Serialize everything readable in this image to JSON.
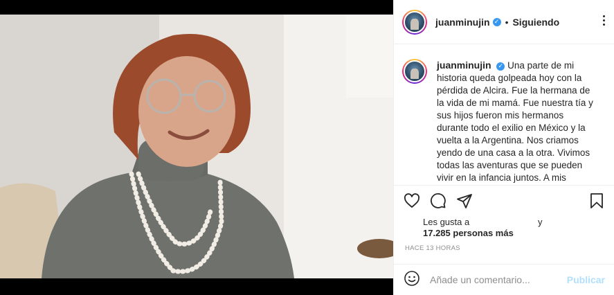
{
  "post": {
    "username": "juanminujin",
    "verified_glyph": "✓",
    "separator": "•",
    "follow_status": "Siguiendo",
    "caption": "Una parte de mi historia queda golpeada hoy con la pérdida de Alcira. Fue la hermana de la vida de mi mamá. Fue nuestra tía y sus hijos fueron mis hermanos durante todo el exilio en México y la vuelta a la Argentina. Nos criamos yendo de una casa a la otra. Vivimos todas las aventuras que se pueden vivir en la infancia juntos. A mis hermanos y a mi",
    "likes_prefix": "Les gusta a",
    "likes_conjunction": "y",
    "likes_count": "17.285 personas más",
    "timestamp": "HACE 13 HORAS"
  },
  "comment": {
    "placeholder": "Añade un comentario...",
    "publish_label": "Publicar"
  },
  "icons": {
    "more": "more-options-icon",
    "like": "heart-icon",
    "comment": "comment-icon",
    "share": "share-icon",
    "save": "bookmark-icon",
    "emoji": "emoji-icon"
  },
  "colors": {
    "verified": "#3897f0",
    "publish_disabled": "#b2dffc",
    "muted": "#8e8e8e",
    "text": "#262626"
  }
}
